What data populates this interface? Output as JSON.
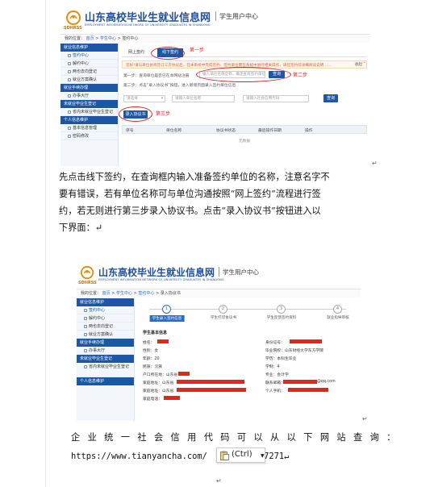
{
  "site": {
    "name": "山东高校毕业生就业信息网",
    "name_en": "EMPLOYMENT INFORMATION NETWORK OF UNIVERSITY GRADUATES IN SHANDONG",
    "logo_abbr": "SDHRSS",
    "portal": "学生用户中心"
  },
  "screenshot1": {
    "breadcrumb": {
      "prefix": "我的位置：",
      "home": "首页",
      "center": "学生中心",
      "current": "签约中心"
    },
    "sidebar": [
      {
        "type": "group",
        "label": "就业信息维护"
      },
      {
        "type": "item",
        "label": "签约中心",
        "active": true
      },
      {
        "type": "item",
        "label": "解约中心"
      },
      {
        "type": "item",
        "label": "两也去向登记"
      },
      {
        "type": "item",
        "label": "就业方案确认"
      },
      {
        "type": "group",
        "label": "就业手续办理"
      },
      {
        "type": "item",
        "label": "办事大厅"
      },
      {
        "type": "group",
        "label": "未就业毕业生登记"
      },
      {
        "type": "item",
        "label": "省内未就业毕业生登记"
      },
      {
        "type": "group",
        "label": "个人信息维护"
      },
      {
        "type": "item",
        "label": "基本信息管理"
      },
      {
        "type": "item",
        "label": "密码修改"
      }
    ],
    "tabs": {
      "online": "网上签约",
      "offline": "线下签约"
    },
    "annotations": {
      "step1": "第一步",
      "step2": "第二步",
      "step3": "第三步"
    },
    "notice": "您好!请与单位协商签订三方协议后，在本系统中完成签约，签约单位需在系统中进行相关操作，请在签约前详细阅读说明……",
    "collapse_label": "收起",
    "step_one_text": "第一步：查询单位是否已在本网站注册",
    "search_placeholder": "输入单位名称全称，确定查找签约单位",
    "search_button": "查询",
    "step_two_text": "第二步：点击“录入协议书”按钮，进入新增页面录入签约单位信息",
    "filters": {
      "f1": "请选择",
      "f2": "请输入单位名称",
      "f3": "请输入社会信用代码",
      "search": "查询"
    },
    "enter_button": "录入协议书",
    "table_headers": [
      "序号",
      "单位名称",
      "协议书状态",
      "最后操作日期",
      "操作"
    ],
    "no_data": "无数据"
  },
  "paragraph": [
    "先点击线下签约，在查询框内输入准备签约单位的名称，注意名字不",
    "要有错误，若有单位名称可与单位沟通按照“网上签约”流程进行签",
    "约，若无则进行第三步录入协议书。点击“录入协议书”按钮进入以",
    "下界面：↵"
  ],
  "screenshot2": {
    "breadcrumb": {
      "prefix": "我的位置：",
      "home": "首页",
      "center": "学生中心",
      "sign": "签约中心",
      "current": "录入协议书"
    },
    "sidebar": [
      {
        "type": "group",
        "label": "就业信息维护"
      },
      {
        "type": "item",
        "label": "签约中心",
        "active": true
      },
      {
        "type": "item",
        "label": "解约中心"
      },
      {
        "type": "item",
        "label": "两也去向登记"
      },
      {
        "type": "item",
        "label": "就业方案确认"
      },
      {
        "type": "group",
        "label": "就业手续办理"
      },
      {
        "type": "item",
        "label": "办事大厅"
      },
      {
        "type": "group",
        "label": "未就业毕业生登记"
      },
      {
        "type": "item",
        "label": "省内未就业毕业生登记"
      },
      {
        "type": "group",
        "label": "个人信息维护"
      }
    ],
    "steps": [
      "学生录入签约信息",
      "学生打印协议书",
      "学生反馈签约资料",
      "就业指导审核"
    ],
    "section_title": "学生基本信息",
    "left_fields": [
      "姓名：",
      "性别：女",
      "年龄：20",
      "民族：汉族",
      "户口所在地：山东省",
      "家庭地址：山东省",
      "家庭地址：山东省",
      "家庭电话："
    ],
    "right_fields": [
      "身份证号：",
      "毕业院校：山东财经大学东方学院",
      "学历：本科生毕业",
      "学制：4",
      "专业：会计学",
      "联系邮箱：",
      "个人手机："
    ],
    "email_suffix": "@qq.com"
  },
  "footer": {
    "credit_text": "企业统一社会信用代码可以从以下网站查询：",
    "url_prefix": "https://www.tianyancha.com/",
    "url_suffix": "77271↵",
    "paste_label": "(Ctrl)",
    "trailing_mark": "↵"
  },
  "colors": {
    "brand_blue": "#1c56a5",
    "annotation_red": "#e02020",
    "redaction": "#e2261f"
  }
}
